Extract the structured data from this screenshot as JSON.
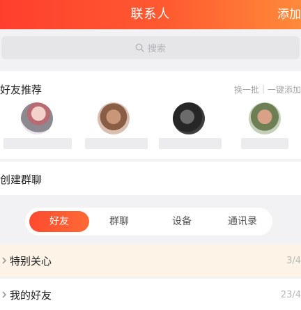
{
  "header": {
    "title": "联系人",
    "action_label": "添加"
  },
  "search": {
    "label": "搜索"
  },
  "recommend": {
    "title": "好友推荐",
    "refresh_label": "换一批",
    "separator": "|",
    "add_all_label": "一键添加"
  },
  "group_chat": {
    "label": "创建群聊"
  },
  "tabs": [
    {
      "label": "好友",
      "active": true
    },
    {
      "label": "群聊",
      "active": false
    },
    {
      "label": "设备",
      "active": false
    },
    {
      "label": "通讯录",
      "active": false
    }
  ],
  "groups": [
    {
      "label": "特别关心",
      "count": "3/4"
    },
    {
      "label": "我的好友",
      "count": "23/4"
    }
  ],
  "colors": {
    "accent": "#ff4a2f",
    "header_gradient_end": "#ff8a3a",
    "highlight_row": "#fdf3e6"
  },
  "icons": {
    "search": "search-icon",
    "chevron": "chevron-right-icon"
  }
}
